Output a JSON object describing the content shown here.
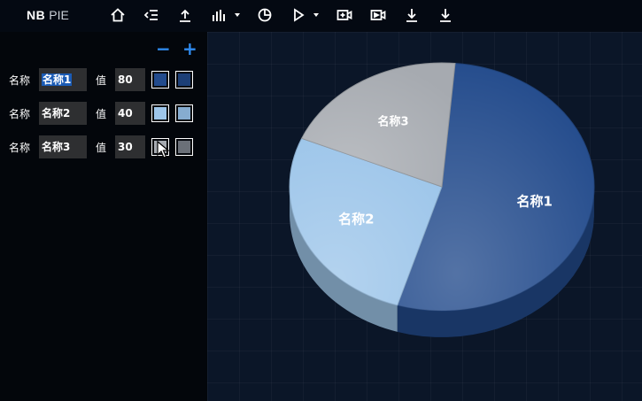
{
  "app": {
    "brand_bold": "NB",
    "brand_light": "PIE"
  },
  "toolbar": {
    "icons": [
      "home-icon",
      "list-indent-icon",
      "upload-icon",
      "bar-chart-icon",
      "pie-chart-icon",
      "play-icon",
      "add-video-icon",
      "video-export-icon",
      "download-icon",
      "download-alt-icon"
    ]
  },
  "panel": {
    "remove_label": "−",
    "add_label": "+",
    "name_label": "名称",
    "value_label": "值",
    "rows": [
      {
        "name": "名称1",
        "value": "80",
        "color": "#234b8c",
        "color2": "#1d3f76"
      },
      {
        "name": "名称2",
        "value": "40",
        "color": "#9ec6ea",
        "color2": "#86acd0"
      },
      {
        "name": "名称3",
        "value": "30",
        "color": "#a6aab0",
        "color2": "#6b7078"
      }
    ]
  },
  "chart_data": {
    "type": "pie",
    "categories": [
      "名称1",
      "名称2",
      "名称3"
    ],
    "values": [
      80,
      40,
      30
    ],
    "colors": [
      "#234b8c",
      "#9ec6ea",
      "#a6aab0"
    ],
    "style": "3d"
  }
}
